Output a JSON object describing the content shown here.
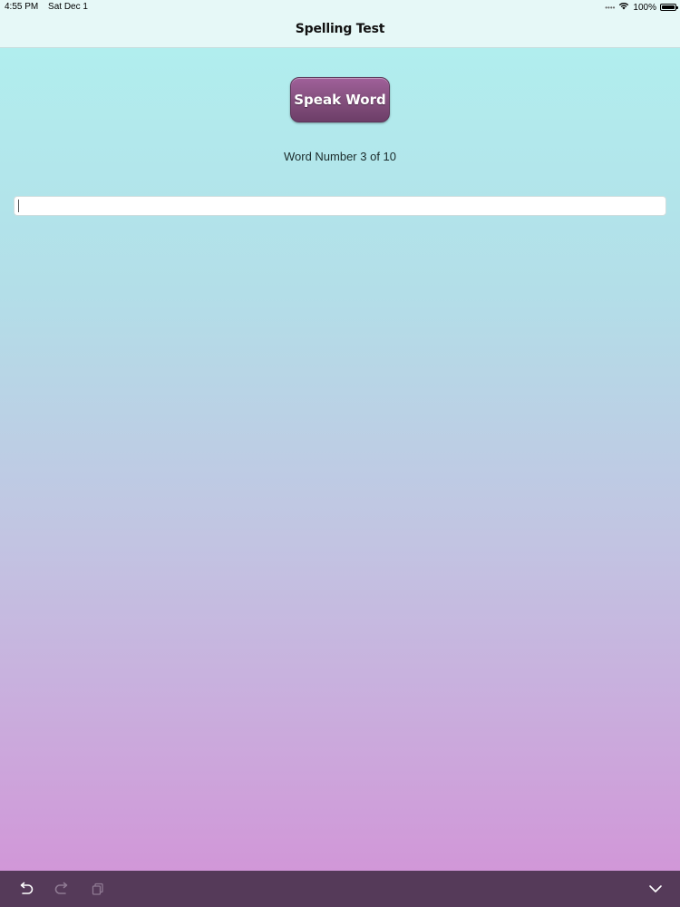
{
  "status_bar": {
    "time": "4:55 PM",
    "date": "Sat Dec 1",
    "battery": "100%",
    "icons": [
      "signal-dots-icon",
      "wifi-icon",
      "battery-icon"
    ]
  },
  "nav": {
    "title": "Spelling Test"
  },
  "main": {
    "speak_button_label": "Speak Word",
    "word_counter": "Word Number 3 of 10",
    "answer_input": {
      "value": "",
      "placeholder": ""
    }
  },
  "shortcut_bar": {
    "icons": [
      "undo-icon",
      "redo-icon",
      "paste-icon",
      "dismiss-keyboard-icon"
    ]
  },
  "colors": {
    "gradient_top": "#b1eeee",
    "gradient_bottom": "#d197d8",
    "button": "#84507e",
    "bottom_bar": "#553a59"
  }
}
